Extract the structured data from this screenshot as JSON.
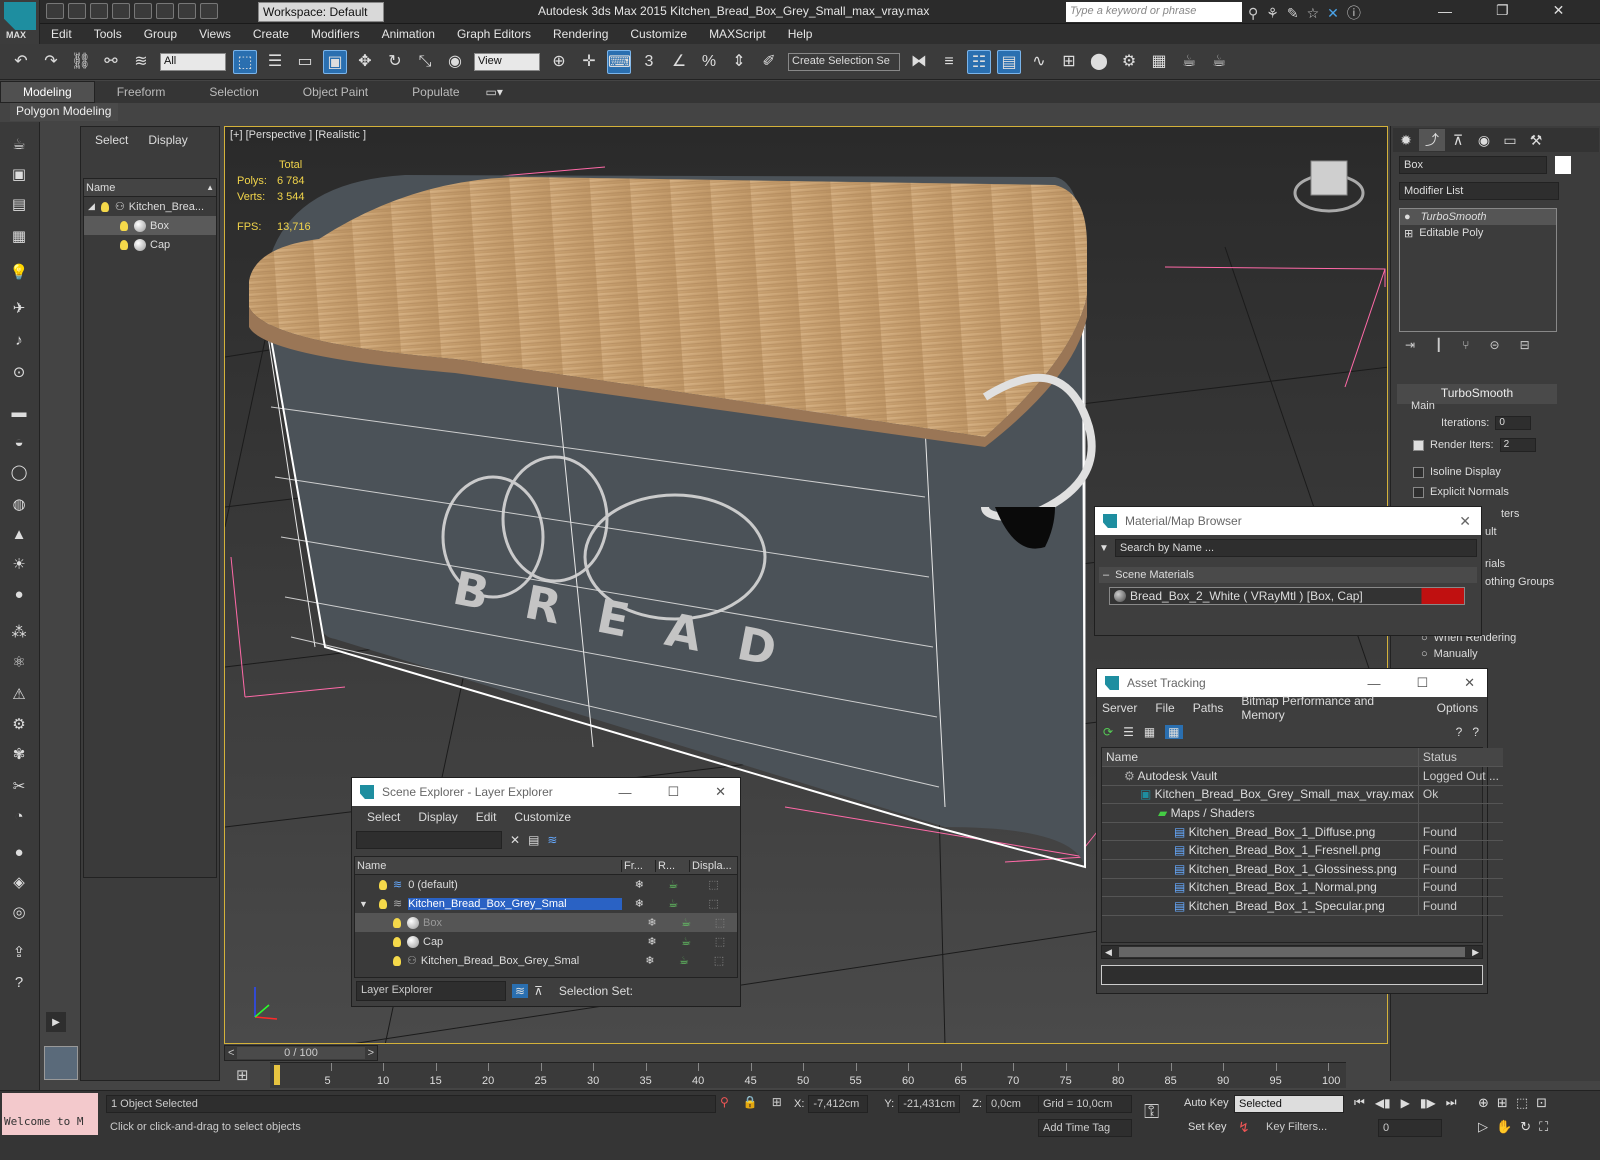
{
  "titlebar": {
    "logo": "MAX",
    "workspace": "Workspace: Default",
    "window_title": "Autodesk 3ds Max  2015    Kitchen_Bread_Box_Grey_Small_max_vray.max",
    "search_placeholder": "Type a keyword or phrase"
  },
  "menu": [
    "Edit",
    "Tools",
    "Group",
    "Views",
    "Create",
    "Modifiers",
    "Animation",
    "Graph Editors",
    "Rendering",
    "Customize",
    "MAXScript",
    "Help"
  ],
  "toolbar": {
    "filter": "All",
    "refcoord": "View",
    "selection_set": "Create Selection Se",
    "snap_labels": [
      "3",
      "%"
    ]
  },
  "ribbon": {
    "tabs": [
      "Modeling",
      "Freeform",
      "Selection",
      "Object Paint",
      "Populate"
    ],
    "active": "Modeling",
    "subtab": "Polygon Modeling"
  },
  "scene_panel": {
    "tabs": [
      "Select",
      "Display"
    ],
    "header": "Name",
    "items": [
      "Kitchen_Brea...",
      "Box",
      "Cap"
    ]
  },
  "viewport": {
    "label": "[+] [Perspective ] [Realistic ]",
    "stats": {
      "total_label": "Total",
      "polys_label": "Polys:",
      "polys": "6 784",
      "verts_label": "Verts:",
      "verts": "3 544",
      "fps_label": "FPS:",
      "fps": "13,716"
    },
    "brand": "BREAD"
  },
  "command_panel": {
    "object_name": "Box",
    "modifier_list": "Modifier List",
    "stack": [
      "TurboSmooth",
      "Editable Poly"
    ],
    "rollout": "TurboSmooth",
    "group": "Main",
    "iterations_label": "Iterations:",
    "iterations": "0",
    "render_iters_label": "Render Iters:",
    "render_iters": "2",
    "isoline": "Isoline Display",
    "explicit": "Explicit Normals",
    "partial": [
      "ters",
      "ult",
      "rials",
      "othing Groups"
    ],
    "update_when_rendering": "When Rendering",
    "update_manually": "Manually"
  },
  "material_browser": {
    "title": "Material/Map Browser",
    "search": "Search by Name ...",
    "section": "Scene Materials",
    "material": "Bread_Box_2_White  ( VRayMtl )  [Box, Cap]"
  },
  "asset_tracking": {
    "title": "Asset Tracking",
    "menu": [
      "Server",
      "File",
      "Paths",
      "Bitmap Performance and Memory",
      "Options"
    ],
    "col_name": "Name",
    "col_status": "Status",
    "rows": [
      {
        "name": "Autodesk Vault",
        "status": "Logged Out ...",
        "indent": 1
      },
      {
        "name": "Kitchen_Bread_Box_Grey_Small_max_vray.max",
        "status": "Ok",
        "indent": 2
      },
      {
        "name": "Maps / Shaders",
        "status": "",
        "indent": 3
      },
      {
        "name": "Kitchen_Bread_Box_1_Diffuse.png",
        "status": "Found",
        "indent": 4
      },
      {
        "name": "Kitchen_Bread_Box_1_Fresnell.png",
        "status": "Found",
        "indent": 4
      },
      {
        "name": "Kitchen_Bread_Box_1_Glossiness.png",
        "status": "Found",
        "indent": 4
      },
      {
        "name": "Kitchen_Bread_Box_1_Normal.png",
        "status": "Found",
        "indent": 4
      },
      {
        "name": "Kitchen_Bread_Box_1_Specular.png",
        "status": "Found",
        "indent": 4
      }
    ]
  },
  "scene_explorer": {
    "title": "Scene Explorer - Layer Explorer",
    "menu": [
      "Select",
      "Display",
      "Edit",
      "Customize"
    ],
    "cols": [
      "Name",
      "Fr...",
      "R...",
      "Displa..."
    ],
    "rows": [
      {
        "name": "0 (default)",
        "kind": "layer",
        "selected": false
      },
      {
        "name": "Kitchen_Bread_Box_Grey_Smal",
        "kind": "layer",
        "selected": true
      },
      {
        "name": "Box",
        "kind": "object",
        "selected": false
      },
      {
        "name": "Cap",
        "kind": "object",
        "selected": false
      },
      {
        "name": "Kitchen_Bread_Box_Grey_Smal",
        "kind": "group",
        "selected": false
      }
    ],
    "footer_mode": "Layer Explorer",
    "selection_set_label": "Selection Set:"
  },
  "timeline": {
    "frame": "0 / 100",
    "ticks": [
      "5",
      "10",
      "15",
      "20",
      "25",
      "30",
      "35",
      "40",
      "45",
      "50",
      "55",
      "60",
      "65",
      "70",
      "75",
      "80",
      "85",
      "90",
      "95",
      "100"
    ]
  },
  "status": {
    "welcome": "Welcome to M",
    "selected": "1 Object Selected",
    "prompt": "Click or click-and-drag to select objects",
    "x_label": "X:",
    "x": "-7,412cm",
    "y_label": "Y:",
    "y": "-21,431cm",
    "z_label": "Z:",
    "z": "0,0cm",
    "grid": "Grid = 10,0cm",
    "add_time_tag": "Add Time Tag",
    "auto_key": "Auto Key",
    "set_key": "Set Key",
    "key_mode": "Selected",
    "key_filters": "Key Filters...",
    "frame": "0"
  }
}
